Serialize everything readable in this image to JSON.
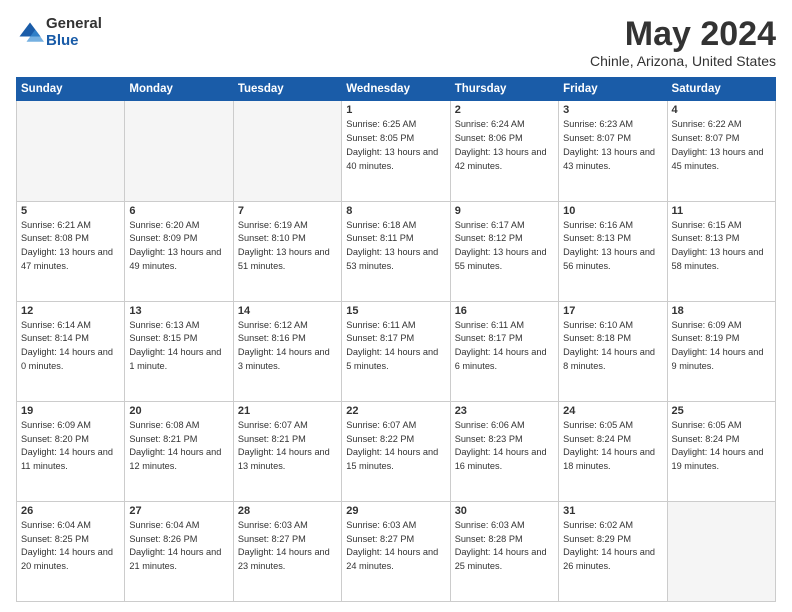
{
  "logo": {
    "general": "General",
    "blue": "Blue"
  },
  "title": "May 2024",
  "location": "Chinle, Arizona, United States",
  "days_header": [
    "Sunday",
    "Monday",
    "Tuesday",
    "Wednesday",
    "Thursday",
    "Friday",
    "Saturday"
  ],
  "weeks": [
    [
      {
        "day": "",
        "empty": true
      },
      {
        "day": "",
        "empty": true
      },
      {
        "day": "",
        "empty": true
      },
      {
        "day": "1",
        "sunrise": "6:25 AM",
        "sunset": "8:05 PM",
        "daylight": "13 hours and 40 minutes."
      },
      {
        "day": "2",
        "sunrise": "6:24 AM",
        "sunset": "8:06 PM",
        "daylight": "13 hours and 42 minutes."
      },
      {
        "day": "3",
        "sunrise": "6:23 AM",
        "sunset": "8:07 PM",
        "daylight": "13 hours and 43 minutes."
      },
      {
        "day": "4",
        "sunrise": "6:22 AM",
        "sunset": "8:07 PM",
        "daylight": "13 hours and 45 minutes."
      }
    ],
    [
      {
        "day": "5",
        "sunrise": "6:21 AM",
        "sunset": "8:08 PM",
        "daylight": "13 hours and 47 minutes."
      },
      {
        "day": "6",
        "sunrise": "6:20 AM",
        "sunset": "8:09 PM",
        "daylight": "13 hours and 49 minutes."
      },
      {
        "day": "7",
        "sunrise": "6:19 AM",
        "sunset": "8:10 PM",
        "daylight": "13 hours and 51 minutes."
      },
      {
        "day": "8",
        "sunrise": "6:18 AM",
        "sunset": "8:11 PM",
        "daylight": "13 hours and 53 minutes."
      },
      {
        "day": "9",
        "sunrise": "6:17 AM",
        "sunset": "8:12 PM",
        "daylight": "13 hours and 55 minutes."
      },
      {
        "day": "10",
        "sunrise": "6:16 AM",
        "sunset": "8:13 PM",
        "daylight": "13 hours and 56 minutes."
      },
      {
        "day": "11",
        "sunrise": "6:15 AM",
        "sunset": "8:13 PM",
        "daylight": "13 hours and 58 minutes."
      }
    ],
    [
      {
        "day": "12",
        "sunrise": "6:14 AM",
        "sunset": "8:14 PM",
        "daylight": "14 hours and 0 minutes."
      },
      {
        "day": "13",
        "sunrise": "6:13 AM",
        "sunset": "8:15 PM",
        "daylight": "14 hours and 1 minute."
      },
      {
        "day": "14",
        "sunrise": "6:12 AM",
        "sunset": "8:16 PM",
        "daylight": "14 hours and 3 minutes."
      },
      {
        "day": "15",
        "sunrise": "6:11 AM",
        "sunset": "8:17 PM",
        "daylight": "14 hours and 5 minutes."
      },
      {
        "day": "16",
        "sunrise": "6:11 AM",
        "sunset": "8:17 PM",
        "daylight": "14 hours and 6 minutes."
      },
      {
        "day": "17",
        "sunrise": "6:10 AM",
        "sunset": "8:18 PM",
        "daylight": "14 hours and 8 minutes."
      },
      {
        "day": "18",
        "sunrise": "6:09 AM",
        "sunset": "8:19 PM",
        "daylight": "14 hours and 9 minutes."
      }
    ],
    [
      {
        "day": "19",
        "sunrise": "6:09 AM",
        "sunset": "8:20 PM",
        "daylight": "14 hours and 11 minutes."
      },
      {
        "day": "20",
        "sunrise": "6:08 AM",
        "sunset": "8:21 PM",
        "daylight": "14 hours and 12 minutes."
      },
      {
        "day": "21",
        "sunrise": "6:07 AM",
        "sunset": "8:21 PM",
        "daylight": "14 hours and 13 minutes."
      },
      {
        "day": "22",
        "sunrise": "6:07 AM",
        "sunset": "8:22 PM",
        "daylight": "14 hours and 15 minutes."
      },
      {
        "day": "23",
        "sunrise": "6:06 AM",
        "sunset": "8:23 PM",
        "daylight": "14 hours and 16 minutes."
      },
      {
        "day": "24",
        "sunrise": "6:05 AM",
        "sunset": "8:24 PM",
        "daylight": "14 hours and 18 minutes."
      },
      {
        "day": "25",
        "sunrise": "6:05 AM",
        "sunset": "8:24 PM",
        "daylight": "14 hours and 19 minutes."
      }
    ],
    [
      {
        "day": "26",
        "sunrise": "6:04 AM",
        "sunset": "8:25 PM",
        "daylight": "14 hours and 20 minutes."
      },
      {
        "day": "27",
        "sunrise": "6:04 AM",
        "sunset": "8:26 PM",
        "daylight": "14 hours and 21 minutes."
      },
      {
        "day": "28",
        "sunrise": "6:03 AM",
        "sunset": "8:27 PM",
        "daylight": "14 hours and 23 minutes."
      },
      {
        "day": "29",
        "sunrise": "6:03 AM",
        "sunset": "8:27 PM",
        "daylight": "14 hours and 24 minutes."
      },
      {
        "day": "30",
        "sunrise": "6:03 AM",
        "sunset": "8:28 PM",
        "daylight": "14 hours and 25 minutes."
      },
      {
        "day": "31",
        "sunrise": "6:02 AM",
        "sunset": "8:29 PM",
        "daylight": "14 hours and 26 minutes."
      },
      {
        "day": "",
        "empty": true
      }
    ]
  ],
  "labels": {
    "sunrise": "Sunrise:",
    "sunset": "Sunset:",
    "daylight": "Daylight:"
  }
}
